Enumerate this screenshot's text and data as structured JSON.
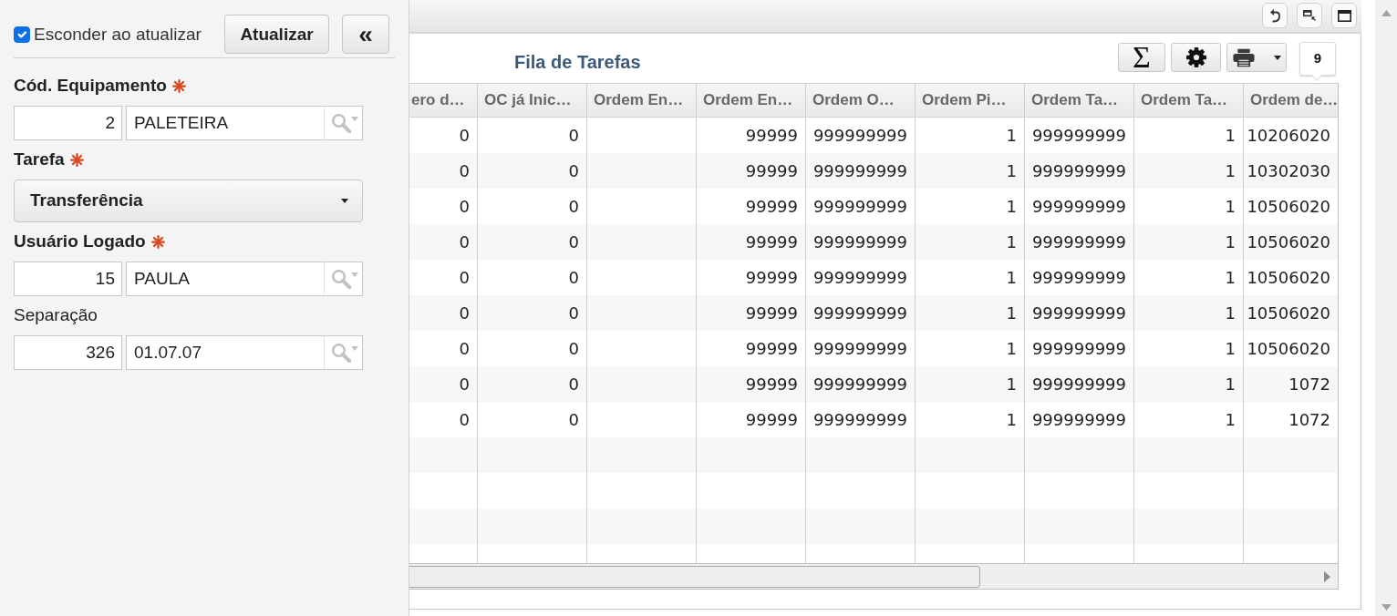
{
  "sidebar": {
    "hide_on_refresh": {
      "label": "Esconder ao atualizar",
      "checked": true
    },
    "refresh_button": "Atualizar",
    "collapse_button": "«",
    "fields": [
      {
        "kind": "lookup",
        "label": "Cód. Equipamento",
        "required": true,
        "code": "2",
        "value": "PALETEIRA"
      },
      {
        "kind": "select",
        "label": "Tarefa",
        "required": true,
        "value": "Transferência"
      },
      {
        "kind": "lookup",
        "label": "Usuário Logado",
        "required": true,
        "code": "15",
        "value": "PAULA"
      },
      {
        "kind": "lookup",
        "label": "Separação",
        "required": false,
        "code": "326",
        "value": "01.07.07"
      }
    ]
  },
  "panel": {
    "title": "Fila de Tarefas",
    "sum_button": "Σ",
    "record_count": "9",
    "table": {
      "columns": [
        "ero d…",
        "OC já Inic…",
        "Ordem En…",
        "Ordem En…",
        "Ordem O…",
        "Ordem Pi…",
        "Ordem Ta…",
        "Ordem Ta…",
        "Ordem de…"
      ],
      "rows": [
        [
          "0",
          "0",
          null,
          "99999",
          "999999999",
          "1",
          "999999999",
          "1",
          "10206020"
        ],
        [
          "0",
          "0",
          null,
          "99999",
          "999999999",
          "1",
          "999999999",
          "1",
          "10302030"
        ],
        [
          "0",
          "0",
          null,
          "99999",
          "999999999",
          "1",
          "999999999",
          "1",
          "10506020"
        ],
        [
          "0",
          "0",
          null,
          "99999",
          "999999999",
          "1",
          "999999999",
          "1",
          "10506020"
        ],
        [
          "0",
          "0",
          null,
          "99999",
          "999999999",
          "1",
          "999999999",
          "1",
          "10506020"
        ],
        [
          "0",
          "0",
          null,
          "99999",
          "999999999",
          "1",
          "999999999",
          "1",
          "10506020"
        ],
        [
          "0",
          "0",
          null,
          "99999",
          "999999999",
          "1",
          "999999999",
          "1",
          "10506020"
        ],
        [
          "0",
          "0",
          null,
          "99999",
          "999999999",
          "1",
          "999999999",
          "1",
          "1072"
        ],
        [
          "0",
          "0",
          null,
          "99999",
          "999999999",
          "1",
          "999999999",
          "1",
          "1072"
        ]
      ]
    }
  }
}
